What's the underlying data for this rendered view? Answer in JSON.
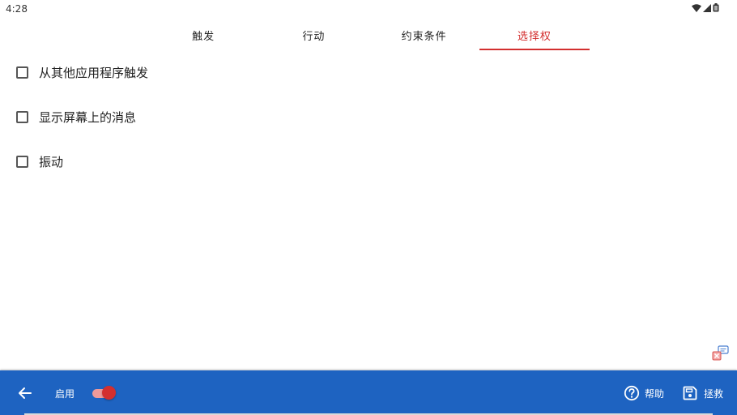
{
  "status_bar": {
    "time": "4:28",
    "icons": [
      "wifi-icon",
      "signal-icon",
      "battery-icon"
    ]
  },
  "tabs": [
    {
      "label": "触发",
      "active": false
    },
    {
      "label": "行动",
      "active": false
    },
    {
      "label": "约束条件",
      "active": false
    },
    {
      "label": "选择权",
      "active": true
    }
  ],
  "options": [
    {
      "label": "从其他应用程序触发",
      "checked": false
    },
    {
      "label": "显示屏幕上的消息",
      "checked": false
    },
    {
      "label": "振动",
      "checked": false
    }
  ],
  "bottom_bar": {
    "enable_label": "启用",
    "enabled": true,
    "help_label": "帮助",
    "save_label": "拯救"
  },
  "colors": {
    "accent": "#d32f2f",
    "bottom_bar": "#1e63c1",
    "toggle_track": "#ef9a9a"
  }
}
